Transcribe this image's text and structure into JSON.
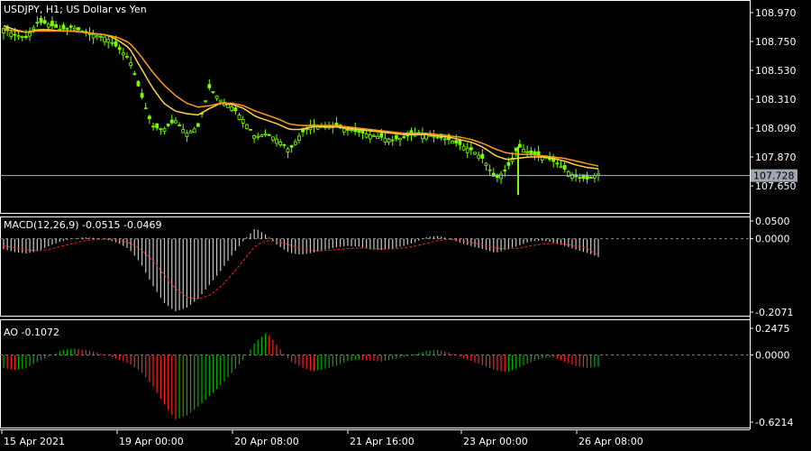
{
  "chart_header": {
    "symbol": "USDJPY",
    "timeframe": "H1",
    "description": "US Dollar vs Yen",
    "title": "USDJPY, H1;  US Dollar vs Yen"
  },
  "price_pane": {
    "y_ticks": [
      "108.970",
      "108.750",
      "108.530",
      "108.310",
      "108.090",
      "107.870",
      "107.650"
    ],
    "current_price_label": "107.728",
    "colors": {
      "bull": "#7CFC00",
      "ma_fast": "#ffd24a",
      "ma_slow": "#ff9a1a",
      "price_line": "#aab4c0",
      "tag_bg": "#a0a6b0"
    }
  },
  "macd_pane": {
    "label": "MACD(12,26,9) -0.0515 -0.0469",
    "y_ticks": [
      "0.0500",
      "0.0000",
      "-0.2071"
    ],
    "colors": {
      "histogram": "#c8c8c8",
      "signal": "#ff2020"
    }
  },
  "ao_pane": {
    "label": "AO -0.1072",
    "y_ticks": [
      "0.2475",
      "0.0000",
      "-0.6214"
    ],
    "colors": {
      "up": "#00b000",
      "down": "#ff2020"
    }
  },
  "time_axis": {
    "labels": [
      "15 Apr 2021",
      "19 Apr 00:00",
      "20 Apr 08:00",
      "21 Apr 16:00",
      "23 Apr 00:00",
      "26 Apr 08:00"
    ]
  },
  "chart_data": [
    {
      "type": "candlestick",
      "ylim": [
        107.55,
        109.02
      ],
      "x_labels": [
        "15 Apr 2021",
        "19 Apr 00:00",
        "20 Apr 08:00",
        "21 Apr 16:00",
        "23 Apr 00:00",
        "26 Apr 08:00"
      ],
      "close_path": [
        108.85,
        108.8,
        108.78,
        108.9,
        108.88,
        108.84,
        108.86,
        108.82,
        108.8,
        108.78,
        108.7,
        108.62,
        108.35,
        108.1,
        108.08,
        108.15,
        108.05,
        108.1,
        108.4,
        108.3,
        108.25,
        108.15,
        108.02,
        108.05,
        108.0,
        107.92,
        108.05,
        108.12,
        108.1,
        108.1,
        108.08,
        108.06,
        108.04,
        108.02,
        108.0,
        108.02,
        108.05,
        108.04,
        108.02,
        108.0,
        107.96,
        107.92,
        107.85,
        107.7,
        107.78,
        107.95,
        107.9,
        107.88,
        107.84,
        107.78,
        107.72,
        107.7,
        107.74
      ],
      "series": [
        {
          "name": "MA fast",
          "values": [
            108.87,
            108.84,
            108.82,
            108.84,
            108.84,
            108.83,
            108.83,
            108.82,
            108.81,
            108.8,
            108.76,
            108.7,
            108.55,
            108.4,
            108.28,
            108.22,
            108.2,
            108.19,
            108.24,
            108.28,
            108.27,
            108.24,
            108.18,
            108.15,
            108.12,
            108.08,
            108.08,
            108.1,
            108.1,
            108.1,
            108.09,
            108.08,
            108.07,
            108.06,
            108.05,
            108.04,
            108.04,
            108.04,
            108.03,
            108.02,
            108.0,
            107.98,
            107.94,
            107.88,
            107.85,
            107.86,
            107.87,
            107.87,
            107.86,
            107.84,
            107.81,
            107.79,
            107.78
          ]
        },
        {
          "name": "MA slow",
          "values": [
            108.84,
            108.83,
            108.82,
            108.83,
            108.83,
            108.83,
            108.83,
            108.82,
            108.81,
            108.8,
            108.78,
            108.74,
            108.64,
            108.52,
            108.42,
            108.34,
            108.28,
            108.25,
            108.26,
            108.28,
            108.28,
            108.26,
            108.22,
            108.19,
            108.16,
            108.12,
            108.11,
            108.11,
            108.11,
            108.11,
            108.1,
            108.09,
            108.08,
            108.07,
            108.06,
            108.05,
            108.05,
            108.05,
            108.04,
            108.03,
            108.02,
            108.0,
            107.97,
            107.93,
            107.9,
            107.89,
            107.89,
            107.88,
            107.87,
            107.86,
            107.84,
            107.82,
            107.8
          ]
        }
      ],
      "last_price": 107.728
    },
    {
      "type": "bar",
      "label": "MACD(12,26,9) -0.0515 -0.0469",
      "ylim": [
        -0.2071,
        0.05
      ],
      "histogram": [
        -0.03,
        -0.038,
        -0.042,
        -0.035,
        -0.02,
        -0.008,
        0.0,
        0.004,
        0.002,
        -0.002,
        -0.012,
        -0.03,
        -0.07,
        -0.13,
        -0.18,
        -0.205,
        -0.195,
        -0.17,
        -0.13,
        -0.09,
        -0.045,
        -0.005,
        0.03,
        0.01,
        -0.02,
        -0.04,
        -0.045,
        -0.04,
        -0.032,
        -0.025,
        -0.02,
        -0.022,
        -0.03,
        -0.032,
        -0.028,
        -0.02,
        -0.01,
        0.005,
        0.008,
        0.0,
        -0.012,
        -0.022,
        -0.03,
        -0.04,
        -0.03,
        -0.02,
        -0.008,
        -0.005,
        -0.01,
        -0.02,
        -0.03,
        -0.04,
        -0.0515
      ],
      "signal": [
        -0.02,
        -0.026,
        -0.032,
        -0.034,
        -0.03,
        -0.022,
        -0.014,
        -0.006,
        -0.002,
        -0.001,
        -0.004,
        -0.012,
        -0.03,
        -0.06,
        -0.1,
        -0.14,
        -0.165,
        -0.17,
        -0.16,
        -0.135,
        -0.1,
        -0.06,
        -0.02,
        -0.005,
        -0.008,
        -0.018,
        -0.028,
        -0.034,
        -0.034,
        -0.031,
        -0.028,
        -0.026,
        -0.027,
        -0.029,
        -0.029,
        -0.026,
        -0.021,
        -0.013,
        -0.005,
        -0.002,
        -0.005,
        -0.011,
        -0.018,
        -0.026,
        -0.029,
        -0.027,
        -0.021,
        -0.015,
        -0.013,
        -0.015,
        -0.02,
        -0.027,
        -0.0469
      ]
    },
    {
      "type": "bar",
      "label": "AO -0.1072",
      "ylim": [
        -0.6214,
        0.2475
      ],
      "values": [
        -0.12,
        -0.14,
        -0.12,
        -0.06,
        -0.01,
        0.04,
        0.06,
        0.05,
        0.03,
        0.0,
        -0.04,
        -0.08,
        -0.15,
        -0.28,
        -0.45,
        -0.6,
        -0.56,
        -0.48,
        -0.38,
        -0.28,
        -0.16,
        -0.04,
        0.12,
        0.21,
        0.08,
        -0.05,
        -0.11,
        -0.15,
        -0.13,
        -0.1,
        -0.06,
        -0.04,
        -0.05,
        -0.06,
        -0.04,
        -0.02,
        0.01,
        0.04,
        0.05,
        0.02,
        -0.02,
        -0.06,
        -0.1,
        -0.14,
        -0.16,
        -0.12,
        -0.07,
        -0.03,
        -0.02,
        -0.06,
        -0.1,
        -0.12,
        -0.1072
      ]
    }
  ]
}
